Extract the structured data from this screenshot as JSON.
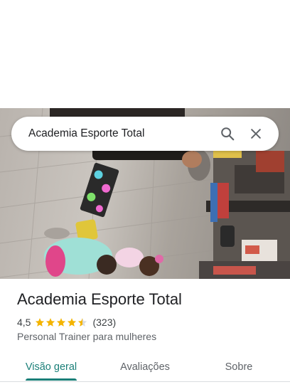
{
  "search": {
    "query": "Academia Esporte Total",
    "search_icon": "search-icon",
    "close_icon": "close-icon"
  },
  "place": {
    "name": "Academia Esporte Total",
    "rating": "4,5",
    "rating_value": 4.5,
    "rating_max": 5,
    "review_count": "(323)",
    "category": "Personal Trainer para mulheres"
  },
  "tabs": [
    {
      "label": "Visão geral",
      "active": true
    },
    {
      "label": "Avaliações",
      "active": false
    },
    {
      "label": "Sobre",
      "active": false
    }
  ],
  "colors": {
    "accent": "#1a7f78",
    "star": "#f4b400",
    "text_primary": "#202124",
    "text_secondary": "#5f6368"
  }
}
